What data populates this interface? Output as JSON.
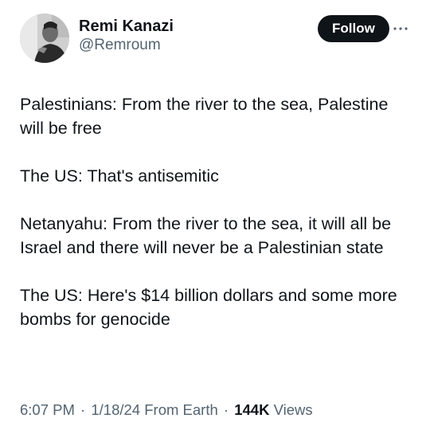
{
  "author": {
    "display_name": "Remi Kanazi",
    "handle": "@Remroum"
  },
  "header": {
    "follow_label": "Follow",
    "more_icon": "more-dots-icon"
  },
  "tweet": {
    "paragraphs": [
      "Palestinians: From the river to the sea, Palestine will be free",
      "The US: That's antisemitic",
      "Netanyahu: From the river to the sea, it will all be Israel and there will never be a Palestinian state",
      "The US: Here's $14 billion dollars and some more bombs for genocide"
    ]
  },
  "meta": {
    "time": "6:07 PM",
    "separator": "·",
    "date": "1/18/24",
    "source": "From Earth",
    "views_count": "144K",
    "views_label": "Views"
  },
  "colors": {
    "text_primary": "#0f1419",
    "text_secondary": "#536471",
    "follow_bg": "#0f1419",
    "follow_text": "#ffffff"
  }
}
